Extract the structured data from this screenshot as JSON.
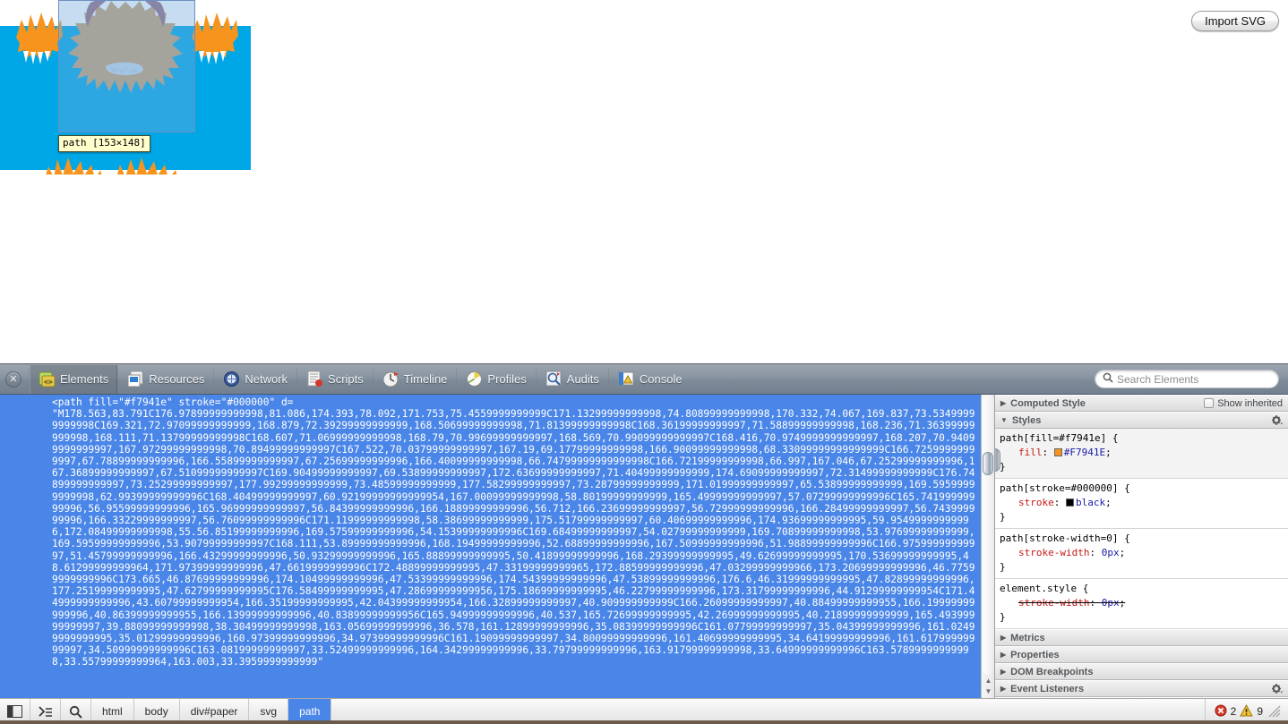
{
  "page": {
    "import_button_label": "Import SVG",
    "artwork": {
      "name": "highland-cow-illustration",
      "sky_color": "#00A7E7",
      "fur_color": "#C8A172",
      "accent_orange": "#F7941E",
      "horn_color": "#9A6F84",
      "muzzle_color": "#C9D7E8"
    },
    "highlight": {
      "tooltip": "path [153×148]",
      "width": 153,
      "height": 148,
      "overlay_color": "#6FA8DC"
    }
  },
  "inspector": {
    "close_label": "✕",
    "tabs": [
      {
        "label": "Elements",
        "icon": "elements-icon",
        "active": true
      },
      {
        "label": "Resources",
        "icon": "resources-icon",
        "active": false
      },
      {
        "label": "Network",
        "icon": "network-icon",
        "active": false
      },
      {
        "label": "Scripts",
        "icon": "scripts-icon",
        "active": false
      },
      {
        "label": "Timeline",
        "icon": "timeline-icon",
        "active": false
      },
      {
        "label": "Profiles",
        "icon": "profiles-icon",
        "active": false
      },
      {
        "label": "Audits",
        "icon": "audits-icon",
        "active": false
      },
      {
        "label": "Console",
        "icon": "console-icon",
        "active": false
      }
    ],
    "search": {
      "placeholder": "Search Elements",
      "value": ""
    },
    "dom": {
      "selected_node": "<path fill=\"#f7941e\" stroke=\"#000000\" d=\n\"M178.563,83.791C176.97899999999998,81.086,174.393,78.092,171.753,75.4559999999999C171.13299999999998,74.80899999999998,170.332,74.067,169.837,73.53499999999998C169.321,72.97099999999999,168.879,72.39299999999999,168.50699999999998,71.81399999999998C168.36199999999997,71.58899999999998,168.236,71.36399999999998,168.111,71.13799999999998C168.607,71.06999999999998,168.79,70.99699999999997,168.569,70.99099999999997C168.416,70.9749999999999997,168.207,70.94099999999997,167.97299999999998,70.89499999999997C167.522,70.03799999999997,167.19,69.17799999999998,166.90099999999998,68.33099999999999999C166.72599999999997,67.78899999999996,166.55899999999997,67.25699999999996,166.40099999999998,66.74799999999999998C166.72199999999998,66.997,167.046,67.25299999999996,167.36899999999997,67.51099999999997C169.90499999999997,69.53899999999997,172.63699999999997,71.40499999999999,174.69099999999997,72.31499999999999C176.74899999999997,73.25299999999997,177.99299999999999,73.48599999999999,177.58299999999997,73.28799999999999,171.01999999999997,65.53899999999999,169.59599999999998,62.99399999999996C168.40499999999997,60.92199999999999954,167.00099999999998,58.80199999999999,165.49999999999997,57.07299999999996C165.74199999999996,56.95599999999996,165.96999999999997,56.84399999999996,166.18899999999996,56.712,166.23699999999997,56.72999999999996,166.28499999999997,56.743999999996,166.33229999999997,56.76099999999996C171.11999999999998,58.38699999999999,175.51799999999997,60.40699999999996,174.93699999999995,59.95499999999996,172.08499999999998,55.56.85199999999996,169.57599999999996,54.15399999999996C169.68499999999997,54.02799999999999,169.70899999999998,53.97699999999999,169.59599999999996,53.90799999999997C168.111,53.89999999999996,168.19499999999996,52.68899999999996,167.50999999999996,51.98899999999996C166.97599999999997,51.45799999999996,166.43299999999996,50.93299999999996,165.88899999999995,50.41899999999996,168.29399999999995,49.62699999999995,170.53699999999995,48.61299999999964,171.97399999999996,47.6619999999996C172.48899999999995,47.33199999999965,172.88599999999996,47.03299999999966,173.20699999999996,46.77599999999996C173.665,46.87699999999996,174.10499999999996,47.53399999999996,174.54399999999996,47.53899999999996,176.6,46.31999999999995,47.82899999999996,177.25199999999995,47.62799999999995C176.58499999999995,47.28699999999956,175.18699999999995,46.22799999999996,173.31799999999996,44.91299999999954C171.44999999999996,43.60799999999954,166.35199999999995,42.04399999999954,166.32899999999997,40.909999999999C166.26099999999997,40.88499999999955,166.19999999999996,40.86399999999955,166.13999999999996,40.83899999999956C165.94999999999996,40.537,165.72699999999995,42.26999999999995,40.21899999999999,165.49399999999997,39.88099999999998,38.30499999999998,163.05699999999996,36.578,161.12899999999996,35.08399999999996C161.07799999999997,35.04399999999996,161.02499999999995,35.01299999999996,160.97399999999996,34.97399999999996C161.19099999999997,34.80099999999996,161.40699999999995,34.64199999999996,161.61799999999997,34.50999999999996C163.08199999999997,33.52499999999996,164.34299999999996,33.79799999999996,163.91799999999998,33.64999999999996C163.57899999999998,33.55799999999964,163.003,33.3959999999999\""
    },
    "sidebar": {
      "computed_style_label": "Computed Style",
      "show_inherited_label": "Show inherited",
      "styles_label": "Styles",
      "rules": [
        {
          "selector": "path[fill=#f7941e] {",
          "property": "fill",
          "value": "#F7941E",
          "swatch": "#F7941E",
          "close": "}",
          "struck": false
        },
        {
          "selector": "path[stroke=#000000] {",
          "property": "stroke",
          "value": "black",
          "swatch": "#000000",
          "close": "}",
          "struck": false
        },
        {
          "selector": "path[stroke-width=0] {",
          "property": "stroke-width",
          "value": "0px",
          "swatch": null,
          "close": "}",
          "struck": false
        },
        {
          "selector": "element.style {",
          "property": "stroke-width",
          "value": "0px",
          "swatch": null,
          "close": "}",
          "struck": true
        }
      ],
      "sections": [
        {
          "label": "Metrics",
          "gear": false
        },
        {
          "label": "Properties",
          "gear": false
        },
        {
          "label": "DOM Breakpoints",
          "gear": false
        },
        {
          "label": "Event Listeners",
          "gear": true
        }
      ]
    },
    "statusbar": {
      "dock_icon": "dock-to-side-icon",
      "console_drawer_icon": "console-drawer-icon",
      "inspect_icon": "magnifier-icon",
      "breadcrumb": [
        {
          "label": "html",
          "selected": false
        },
        {
          "label": "body",
          "selected": false
        },
        {
          "label": "div#paper",
          "selected": false
        },
        {
          "label": "svg",
          "selected": false
        },
        {
          "label": "path",
          "selected": true
        }
      ],
      "error_count": "2",
      "warning_count": "9"
    }
  }
}
